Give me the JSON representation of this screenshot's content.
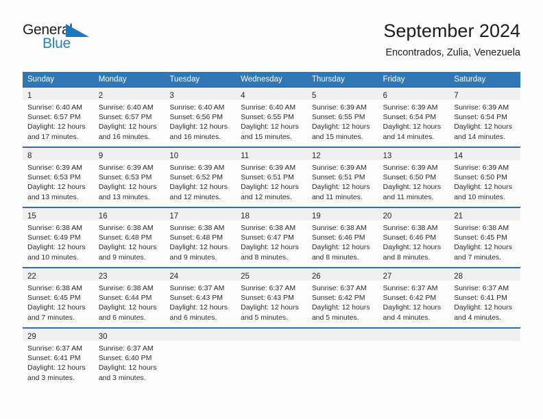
{
  "brand": {
    "name_dark": "General",
    "name_blue": "Blue",
    "flag_color": "#1f77bc",
    "blue_color": "#2980c4"
  },
  "header": {
    "title": "September 2024",
    "subtitle": "Encontrados, Zulia, Venezuela"
  },
  "theme": {
    "header_blue": "#3077b8",
    "cell_rule_blue": "#2a6db0",
    "daynum_bg": "#f0f0f0",
    "page_bg": "#fdfdfd"
  },
  "weekdays": [
    "Sunday",
    "Monday",
    "Tuesday",
    "Wednesday",
    "Thursday",
    "Friday",
    "Saturday"
  ],
  "weeks": [
    [
      {
        "day": "1",
        "sunrise": "Sunrise: 6:40 AM",
        "sunset": "Sunset: 6:57 PM",
        "daylight1": "Daylight: 12 hours",
        "daylight2": "and 17 minutes."
      },
      {
        "day": "2",
        "sunrise": "Sunrise: 6:40 AM",
        "sunset": "Sunset: 6:57 PM",
        "daylight1": "Daylight: 12 hours",
        "daylight2": "and 16 minutes."
      },
      {
        "day": "3",
        "sunrise": "Sunrise: 6:40 AM",
        "sunset": "Sunset: 6:56 PM",
        "daylight1": "Daylight: 12 hours",
        "daylight2": "and 16 minutes."
      },
      {
        "day": "4",
        "sunrise": "Sunrise: 6:40 AM",
        "sunset": "Sunset: 6:55 PM",
        "daylight1": "Daylight: 12 hours",
        "daylight2": "and 15 minutes."
      },
      {
        "day": "5",
        "sunrise": "Sunrise: 6:39 AM",
        "sunset": "Sunset: 6:55 PM",
        "daylight1": "Daylight: 12 hours",
        "daylight2": "and 15 minutes."
      },
      {
        "day": "6",
        "sunrise": "Sunrise: 6:39 AM",
        "sunset": "Sunset: 6:54 PM",
        "daylight1": "Daylight: 12 hours",
        "daylight2": "and 14 minutes."
      },
      {
        "day": "7",
        "sunrise": "Sunrise: 6:39 AM",
        "sunset": "Sunset: 6:54 PM",
        "daylight1": "Daylight: 12 hours",
        "daylight2": "and 14 minutes."
      }
    ],
    [
      {
        "day": "8",
        "sunrise": "Sunrise: 6:39 AM",
        "sunset": "Sunset: 6:53 PM",
        "daylight1": "Daylight: 12 hours",
        "daylight2": "and 13 minutes."
      },
      {
        "day": "9",
        "sunrise": "Sunrise: 6:39 AM",
        "sunset": "Sunset: 6:53 PM",
        "daylight1": "Daylight: 12 hours",
        "daylight2": "and 13 minutes."
      },
      {
        "day": "10",
        "sunrise": "Sunrise: 6:39 AM",
        "sunset": "Sunset: 6:52 PM",
        "daylight1": "Daylight: 12 hours",
        "daylight2": "and 12 minutes."
      },
      {
        "day": "11",
        "sunrise": "Sunrise: 6:39 AM",
        "sunset": "Sunset: 6:51 PM",
        "daylight1": "Daylight: 12 hours",
        "daylight2": "and 12 minutes."
      },
      {
        "day": "12",
        "sunrise": "Sunrise: 6:39 AM",
        "sunset": "Sunset: 6:51 PM",
        "daylight1": "Daylight: 12 hours",
        "daylight2": "and 11 minutes."
      },
      {
        "day": "13",
        "sunrise": "Sunrise: 6:39 AM",
        "sunset": "Sunset: 6:50 PM",
        "daylight1": "Daylight: 12 hours",
        "daylight2": "and 11 minutes."
      },
      {
        "day": "14",
        "sunrise": "Sunrise: 6:39 AM",
        "sunset": "Sunset: 6:50 PM",
        "daylight1": "Daylight: 12 hours",
        "daylight2": "and 10 minutes."
      }
    ],
    [
      {
        "day": "15",
        "sunrise": "Sunrise: 6:38 AM",
        "sunset": "Sunset: 6:49 PM",
        "daylight1": "Daylight: 12 hours",
        "daylight2": "and 10 minutes."
      },
      {
        "day": "16",
        "sunrise": "Sunrise: 6:38 AM",
        "sunset": "Sunset: 6:48 PM",
        "daylight1": "Daylight: 12 hours",
        "daylight2": "and 9 minutes."
      },
      {
        "day": "17",
        "sunrise": "Sunrise: 6:38 AM",
        "sunset": "Sunset: 6:48 PM",
        "daylight1": "Daylight: 12 hours",
        "daylight2": "and 9 minutes."
      },
      {
        "day": "18",
        "sunrise": "Sunrise: 6:38 AM",
        "sunset": "Sunset: 6:47 PM",
        "daylight1": "Daylight: 12 hours",
        "daylight2": "and 8 minutes."
      },
      {
        "day": "19",
        "sunrise": "Sunrise: 6:38 AM",
        "sunset": "Sunset: 6:46 PM",
        "daylight1": "Daylight: 12 hours",
        "daylight2": "and 8 minutes."
      },
      {
        "day": "20",
        "sunrise": "Sunrise: 6:38 AM",
        "sunset": "Sunset: 6:46 PM",
        "daylight1": "Daylight: 12 hours",
        "daylight2": "and 8 minutes."
      },
      {
        "day": "21",
        "sunrise": "Sunrise: 6:38 AM",
        "sunset": "Sunset: 6:45 PM",
        "daylight1": "Daylight: 12 hours",
        "daylight2": "and 7 minutes."
      }
    ],
    [
      {
        "day": "22",
        "sunrise": "Sunrise: 6:38 AM",
        "sunset": "Sunset: 6:45 PM",
        "daylight1": "Daylight: 12 hours",
        "daylight2": "and 7 minutes."
      },
      {
        "day": "23",
        "sunrise": "Sunrise: 6:38 AM",
        "sunset": "Sunset: 6:44 PM",
        "daylight1": "Daylight: 12 hours",
        "daylight2": "and 6 minutes."
      },
      {
        "day": "24",
        "sunrise": "Sunrise: 6:37 AM",
        "sunset": "Sunset: 6:43 PM",
        "daylight1": "Daylight: 12 hours",
        "daylight2": "and 6 minutes."
      },
      {
        "day": "25",
        "sunrise": "Sunrise: 6:37 AM",
        "sunset": "Sunset: 6:43 PM",
        "daylight1": "Daylight: 12 hours",
        "daylight2": "and 5 minutes."
      },
      {
        "day": "26",
        "sunrise": "Sunrise: 6:37 AM",
        "sunset": "Sunset: 6:42 PM",
        "daylight1": "Daylight: 12 hours",
        "daylight2": "and 5 minutes."
      },
      {
        "day": "27",
        "sunrise": "Sunrise: 6:37 AM",
        "sunset": "Sunset: 6:42 PM",
        "daylight1": "Daylight: 12 hours",
        "daylight2": "and 4 minutes."
      },
      {
        "day": "28",
        "sunrise": "Sunrise: 6:37 AM",
        "sunset": "Sunset: 6:41 PM",
        "daylight1": "Daylight: 12 hours",
        "daylight2": "and 4 minutes."
      }
    ],
    [
      {
        "day": "29",
        "sunrise": "Sunrise: 6:37 AM",
        "sunset": "Sunset: 6:41 PM",
        "daylight1": "Daylight: 12 hours",
        "daylight2": "and 3 minutes."
      },
      {
        "day": "30",
        "sunrise": "Sunrise: 6:37 AM",
        "sunset": "Sunset: 6:40 PM",
        "daylight1": "Daylight: 12 hours",
        "daylight2": "and 3 minutes."
      },
      {
        "day": "",
        "sunrise": "",
        "sunset": "",
        "daylight1": "",
        "daylight2": ""
      },
      {
        "day": "",
        "sunrise": "",
        "sunset": "",
        "daylight1": "",
        "daylight2": ""
      },
      {
        "day": "",
        "sunrise": "",
        "sunset": "",
        "daylight1": "",
        "daylight2": ""
      },
      {
        "day": "",
        "sunrise": "",
        "sunset": "",
        "daylight1": "",
        "daylight2": ""
      },
      {
        "day": "",
        "sunrise": "",
        "sunset": "",
        "daylight1": "",
        "daylight2": ""
      }
    ]
  ]
}
